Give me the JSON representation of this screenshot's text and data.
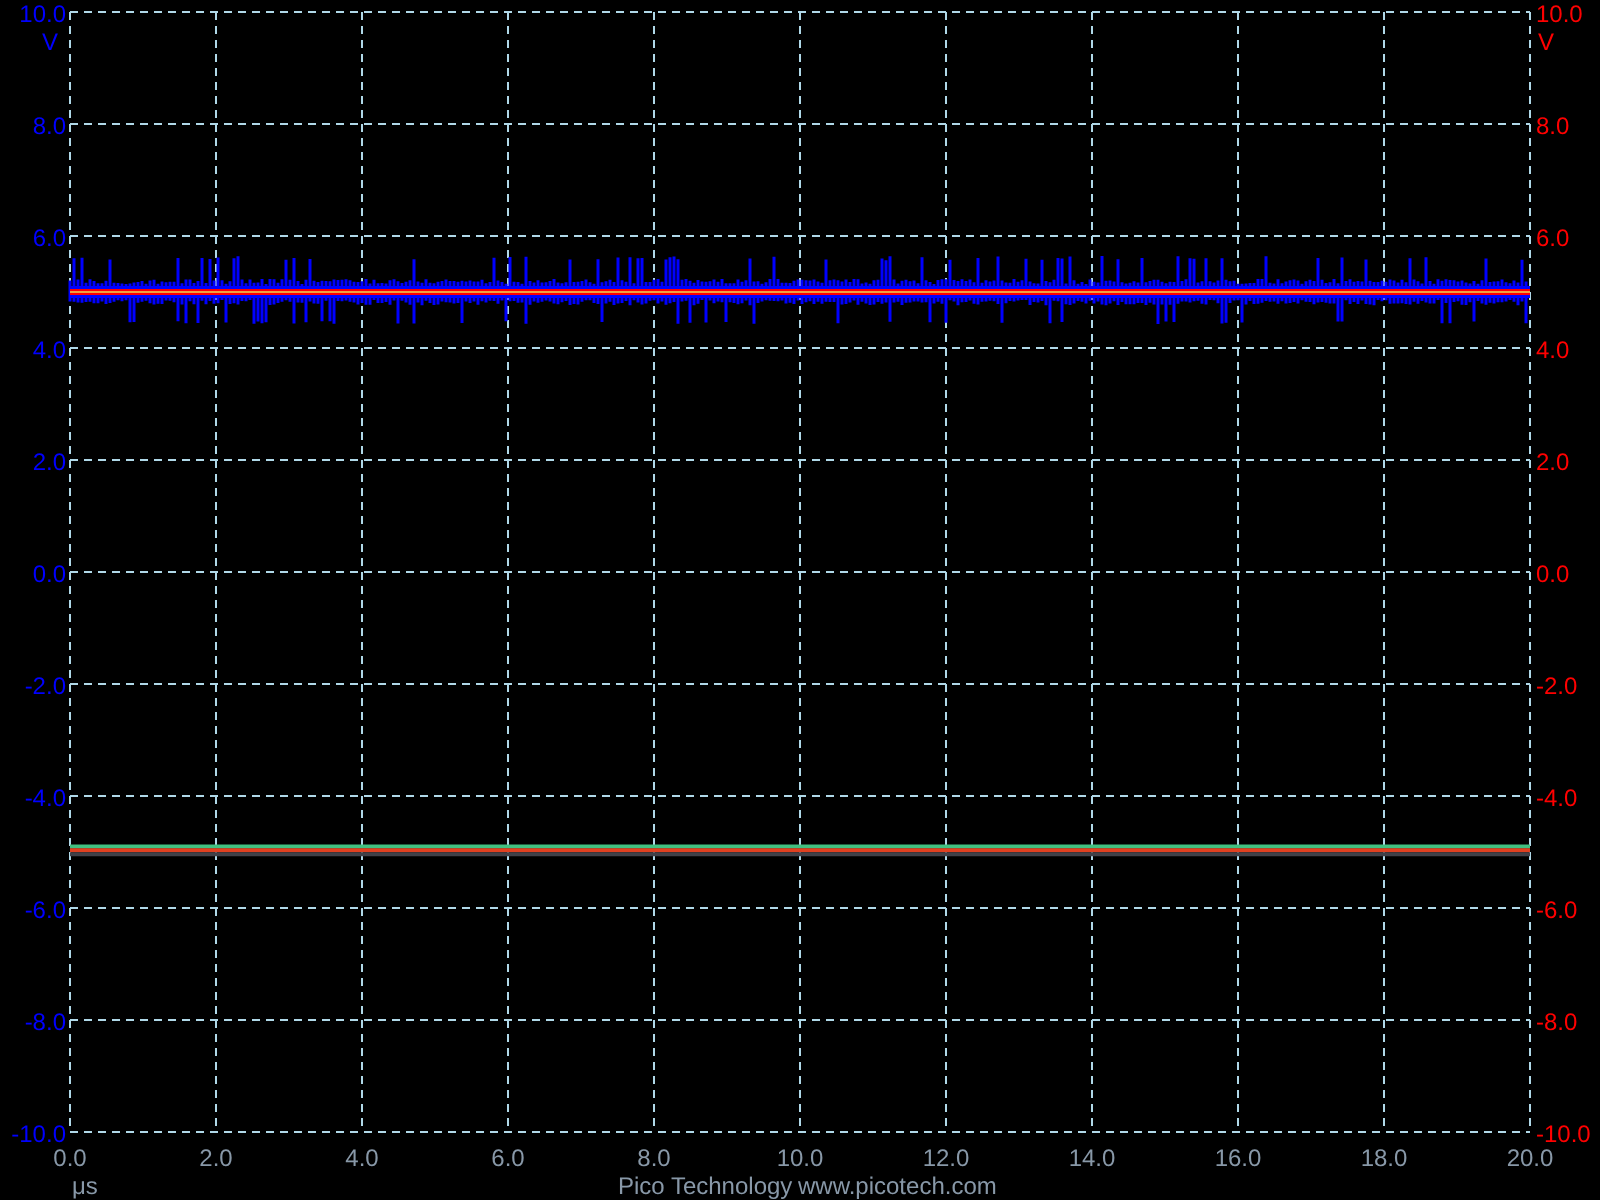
{
  "chart_data": {
    "type": "line",
    "xlabel": "μs",
    "ylabel": "V",
    "x": [
      0,
      20
    ],
    "series": [
      {
        "color": "#0000ff",
        "values": [
          5.0,
          5.0
        ]
      },
      {
        "color": "#ff0000",
        "values": [
          5.0,
          5.0
        ]
      },
      {
        "color": "#f0a040",
        "values": [
          5.0,
          5.0
        ]
      },
      {
        "color": "#40c080",
        "values": [
          -4.9,
          -4.9
        ]
      },
      {
        "color": "#e04020",
        "values": [
          -4.97,
          -4.97
        ]
      },
      {
        "color": "#404048",
        "values": [
          -5.04,
          -5.04
        ]
      }
    ],
    "grid": true,
    "xlim": [
      0,
      20
    ],
    "ylim": [
      -10,
      10
    ],
    "xticks": [
      {
        "value": 0,
        "label": "0.0"
      },
      {
        "value": 2,
        "label": "2.0"
      },
      {
        "value": 4,
        "label": "4.0"
      },
      {
        "value": 6,
        "label": "6.0"
      },
      {
        "value": 8,
        "label": "8.0"
      },
      {
        "value": 10,
        "label": "10.0"
      },
      {
        "value": 12,
        "label": "12.0"
      },
      {
        "value": 14,
        "label": "14.0"
      },
      {
        "value": 16,
        "label": "16.0"
      },
      {
        "value": 18,
        "label": "18.0"
      },
      {
        "value": 20,
        "label": "20.0"
      }
    ],
    "yticks": [
      {
        "value": 10,
        "label": "10.0"
      },
      {
        "value": 8,
        "label": "8.0"
      },
      {
        "value": 6,
        "label": "6.0"
      },
      {
        "value": 4,
        "label": "4.0"
      },
      {
        "value": 2,
        "label": "2.0"
      },
      {
        "value": 0,
        "label": "0.0"
      },
      {
        "value": -2,
        "label": "-2.0"
      },
      {
        "value": -4,
        "label": "-4.0"
      },
      {
        "value": -6,
        "label": "-6.0"
      },
      {
        "value": -8,
        "label": "-8.0"
      },
      {
        "value": -10,
        "label": "-10.0"
      }
    ]
  },
  "right_axis": {
    "unit": "V",
    "labels": [
      "10.0",
      "8.0",
      "6.0",
      "4.0",
      "2.0",
      "0.0",
      "-2.0",
      "-4.0",
      "-6.0",
      "-8.0",
      "-10.0"
    ]
  },
  "footer": {
    "company": "Pico Technology",
    "website": "www.picotech.com"
  }
}
